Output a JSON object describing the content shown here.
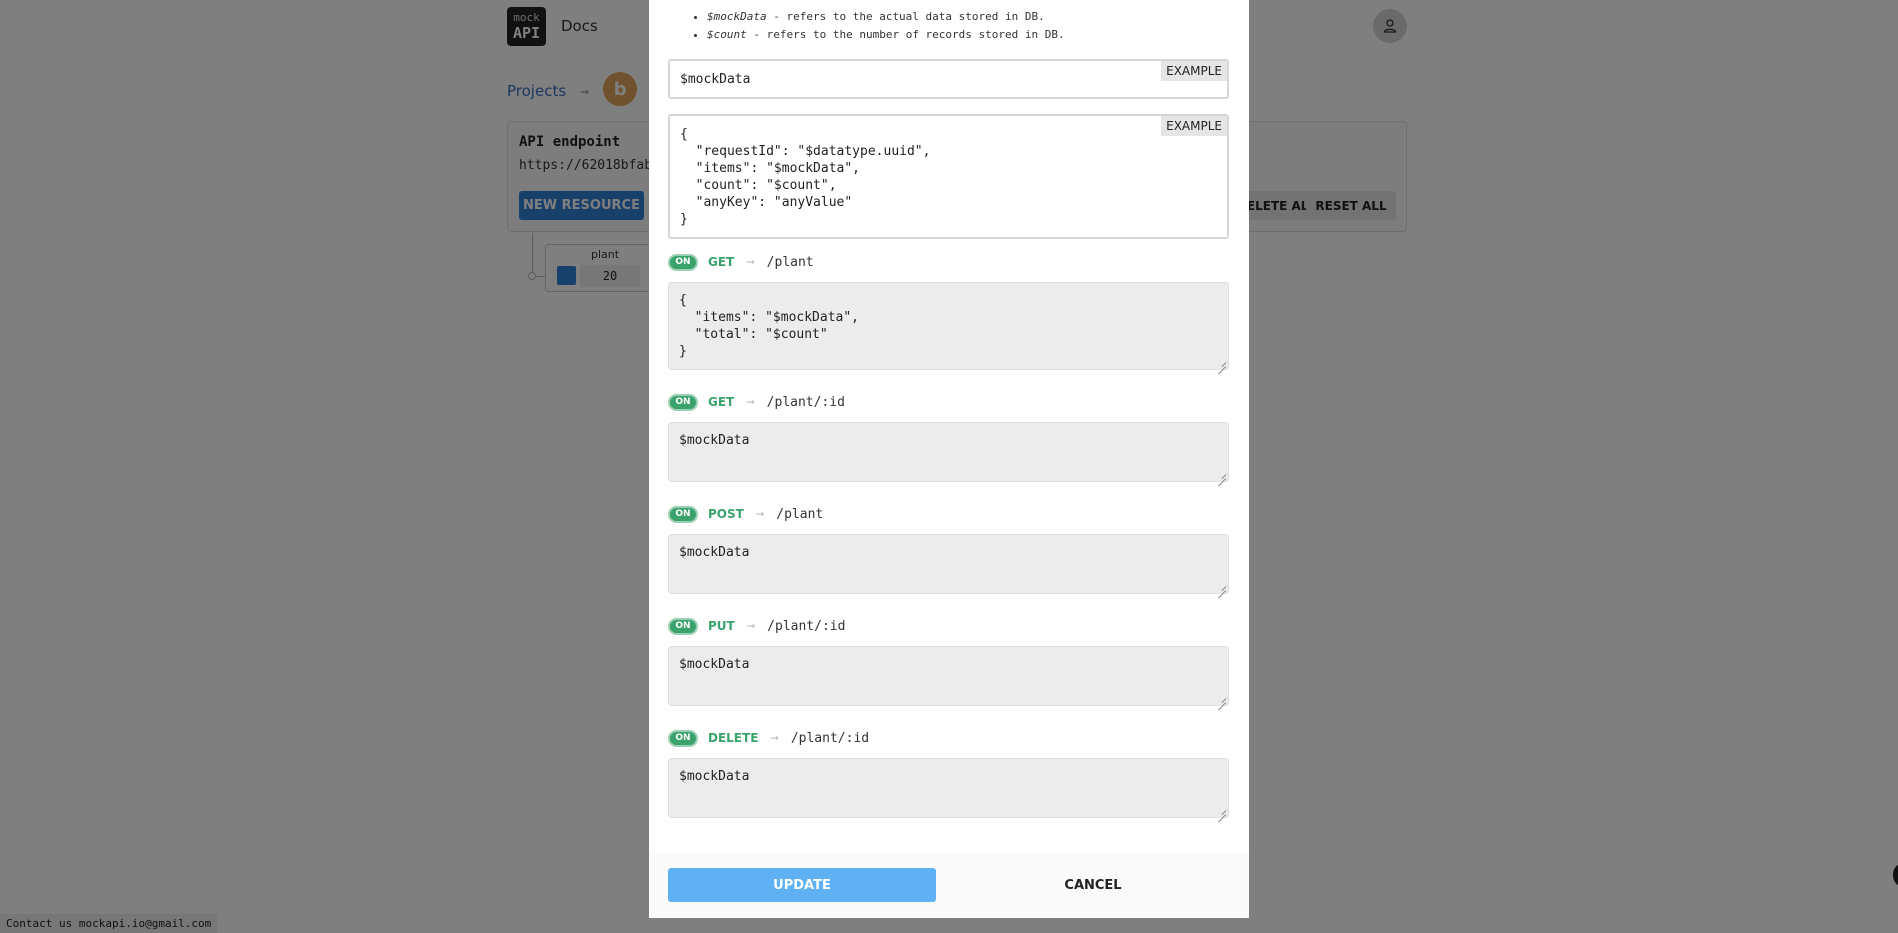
{
  "background": {
    "logo": {
      "line1": "mock",
      "line2": "API"
    },
    "docs_link": "Docs",
    "breadcrumb": {
      "projects": "Projects",
      "arrow": "→",
      "project_initial": "b"
    },
    "api_card": {
      "title": "API endpoint",
      "url": "https://62018bfab",
      "new_resource": "NEW RESOURCE",
      "delete_all": "DELETE ALL",
      "reset_all": "RESET ALL"
    },
    "resource": {
      "name": "plant",
      "count": "20",
      "color": "#2f80d6"
    },
    "contact": "Contact us mockapi.io@gmail.com"
  },
  "modal": {
    "notes": [
      {
        "term": "$mockData",
        "text": " - refers to the actual data stored in DB."
      },
      {
        "term": "$count",
        "text": " - refers to the number of records stored in DB."
      }
    ],
    "object_template": {
      "value": "$mockData",
      "example_label": "EXAMPLE"
    },
    "list_template": {
      "value": "{\n  \"requestId\": \"$datatype.uuid\",\n  \"items\": \"$mockData\",\n  \"count\": \"$count\",\n  \"anyKey\": \"anyValue\"\n}",
      "example_label": "EXAMPLE"
    },
    "routes": [
      {
        "toggle": "ON",
        "method": "GET",
        "arrow": "→",
        "path": "/plant",
        "template": "{\n  \"items\": \"$mockData\",\n  \"total\": \"$count\"\n}"
      },
      {
        "toggle": "ON",
        "method": "GET",
        "arrow": "→",
        "path": "/plant/:id",
        "template": "$mockData"
      },
      {
        "toggle": "ON",
        "method": "POST",
        "arrow": "→",
        "path": "/plant",
        "template": "$mockData"
      },
      {
        "toggle": "ON",
        "method": "PUT",
        "arrow": "→",
        "path": "/plant/:id",
        "template": "$mockData"
      },
      {
        "toggle": "ON",
        "method": "DELETE",
        "arrow": "→",
        "path": "/plant/:id",
        "template": "$mockData"
      }
    ],
    "footer": {
      "update": "UPDATE",
      "cancel": "CANCEL"
    }
  },
  "colors": {
    "accent": "#3aa26b",
    "primary": "#5fb1f3",
    "brand_blue": "#2f80d6"
  }
}
